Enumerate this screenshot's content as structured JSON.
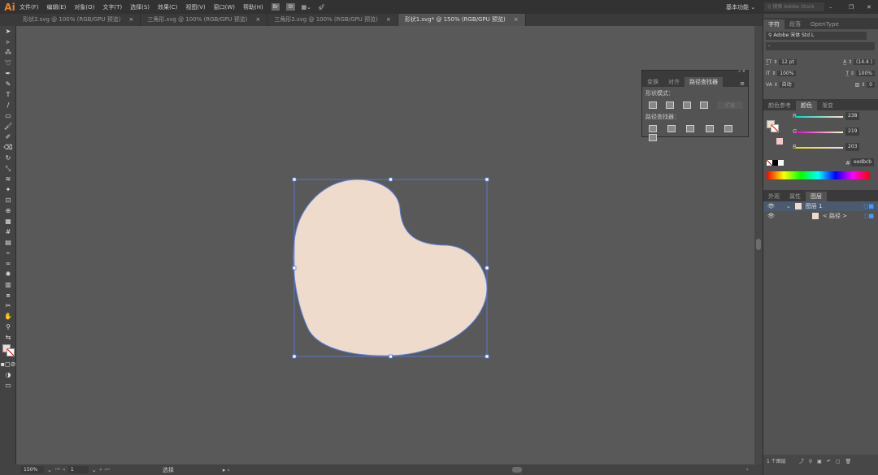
{
  "app": {
    "logo": "Ai",
    "menu": [
      "文件(F)",
      "编辑(E)",
      "对象(O)",
      "文字(T)",
      "选择(S)",
      "效果(C)",
      "视图(V)",
      "窗口(W)",
      "帮助(H)"
    ],
    "bridge": "Br",
    "stock": "St",
    "workspace": "基本功能",
    "search_placeholder": "搜索 Adobe Stock"
  },
  "tabs": [
    {
      "label": "形状2.svg @ 100% (RGB/GPU 预览)"
    },
    {
      "label": "三角形.svg @ 100% (RGB/GPU 预览)"
    },
    {
      "label": "三角形2.svg @ 100% (RGB/GPU 预览)"
    },
    {
      "label": "形状1.svg* @ 150% (RGB/GPU 预览)",
      "active": true
    }
  ],
  "close_glyph": "×",
  "shape": {
    "fill": "#eedbcb",
    "stroke": "#5b7de0"
  },
  "pathfinder": {
    "tabs": [
      "变换",
      "对齐",
      "路径查找器"
    ],
    "shape_modes": "形状模式：",
    "expand": "扩展",
    "pathfinders": "路径查找器："
  },
  "character": {
    "tabs": [
      "字符",
      "段落",
      "OpenType"
    ],
    "font": "Adobe 宋体 Std L",
    "style": "-",
    "size": "12 pt",
    "leading": "(14.4 )",
    "vscale": "100%",
    "hscale": "100%",
    "kerning": "自动",
    "tracking": "0"
  },
  "color": {
    "tabs": [
      "颜色参考",
      "颜色",
      "渐变"
    ],
    "r": 238,
    "g": 219,
    "b": 203,
    "r_label": "R",
    "g_label": "G",
    "b_label": "B",
    "hex_prefix": "#",
    "hex": "eedbcb"
  },
  "layers": {
    "tabs": [
      "外观",
      "属性",
      "图层"
    ],
    "items": [
      {
        "name": "图层 1"
      },
      {
        "name": "< 路径 >"
      }
    ],
    "count": "1 个图层"
  },
  "status": {
    "zoom": "150%",
    "artboard": "1",
    "tool": "选择"
  }
}
